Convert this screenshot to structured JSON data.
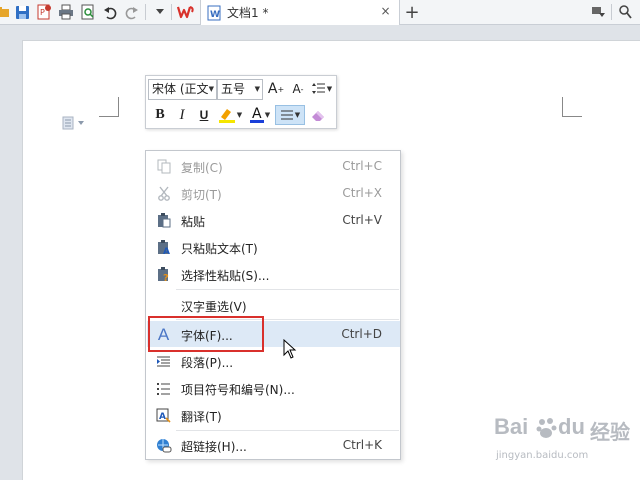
{
  "toolbar": {
    "icons": [
      "folder-icon",
      "save-icon",
      "export-pdf-icon",
      "print-icon",
      "print-preview-icon",
      "undo-icon",
      "redo-icon",
      "dropdown-icon",
      "wps-logo-icon",
      "new-tab-icon",
      "pin-icon",
      "user-icon"
    ],
    "doc_tab": {
      "title": "文档1 *",
      "close_glyph": "×"
    },
    "new_tab_glyph": "+"
  },
  "mini_toolbar": {
    "font_name": "宋体 (正文",
    "font_size": "五号",
    "buttons": {
      "grow_font": "A",
      "shrink_font": "A",
      "bold": "B",
      "italic": "I",
      "underline": "U",
      "font_color": "A"
    },
    "colors": {
      "highlight": "#f5e600",
      "font_color": "#1a3fd9",
      "eraser": "#c38bd6"
    }
  },
  "context_menu": {
    "items": [
      {
        "label": "复制(C)",
        "shortcut": "Ctrl+C",
        "icon": "copy-icon",
        "disabled": true
      },
      {
        "label": "剪切(T)",
        "shortcut": "Ctrl+X",
        "icon": "cut-icon",
        "disabled": true
      },
      {
        "label": "粘贴",
        "shortcut": "Ctrl+V",
        "icon": "paste-icon",
        "disabled": false
      },
      {
        "label": "只粘贴文本(T)",
        "shortcut": "",
        "icon": "paste-text-icon",
        "disabled": false
      },
      {
        "label": "选择性粘贴(S)...",
        "shortcut": "",
        "icon": "paste-special-icon",
        "disabled": false
      },
      {
        "label": "汉字重选(V)",
        "shortcut": "",
        "icon": "",
        "disabled": false
      },
      {
        "label": "字体(F)...",
        "shortcut": "Ctrl+D",
        "icon": "font-icon",
        "disabled": false,
        "highlighted": true
      },
      {
        "label": "段落(P)...",
        "shortcut": "",
        "icon": "paragraph-icon",
        "disabled": false
      },
      {
        "label": "项目符号和编号(N)...",
        "shortcut": "",
        "icon": "bullet-list-icon",
        "disabled": false
      },
      {
        "label": "翻译(T)",
        "shortcut": "",
        "icon": "translate-icon",
        "disabled": false
      },
      {
        "label": "超链接(H)...",
        "shortcut": "Ctrl+K",
        "icon": "hyperlink-icon",
        "disabled": false
      }
    ]
  },
  "watermark": {
    "brand": "Bai",
    "brand2": "经验",
    "url": "jingyan.baidu.com"
  },
  "accent": {
    "highlight_bg": "#dde9f6",
    "annotation_red": "#d9302c"
  }
}
